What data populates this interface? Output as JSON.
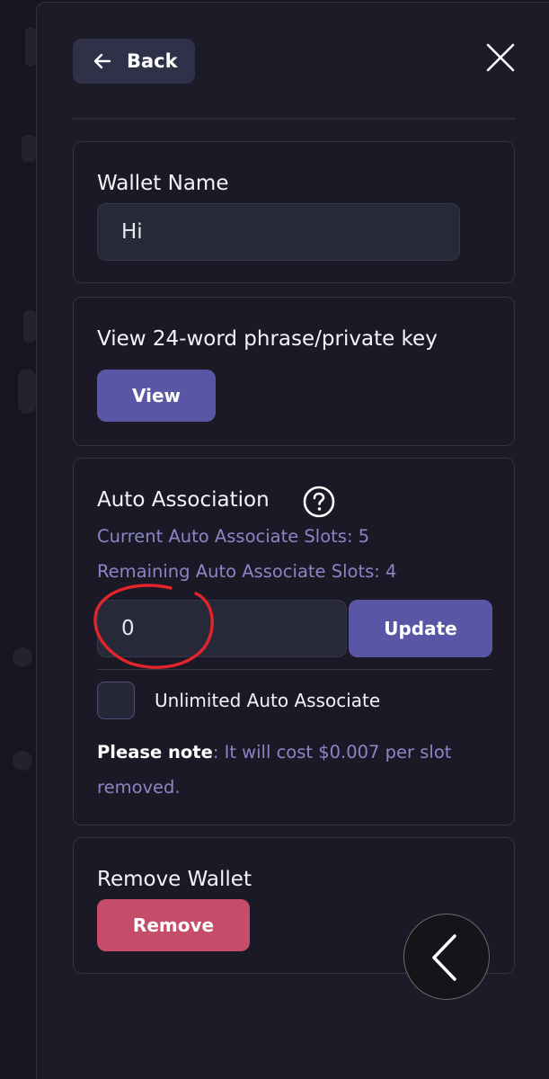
{
  "header": {
    "back_label": "Back"
  },
  "wallet_name": {
    "title": "Wallet Name",
    "value": "Hi"
  },
  "phrase": {
    "title": "View 24-word phrase/private key",
    "button_label": "View"
  },
  "auto_association": {
    "title": "Auto Association",
    "current_slots": "Current Auto Associate Slots: 5",
    "remaining_slots": "Remaining Auto Associate Slots: 4",
    "input_value": "0",
    "update_label": "Update",
    "unlimited_label": "Unlimited Auto Associate",
    "note_bold": "Please note",
    "note_text": ": It will cost $0.007 per slot removed."
  },
  "remove_wallet": {
    "title": "Remove Wallet",
    "button_label": "Remove"
  },
  "colors": {
    "accent": "#5a56a6",
    "danger": "#c64d69",
    "annotation": "#e3242b"
  }
}
